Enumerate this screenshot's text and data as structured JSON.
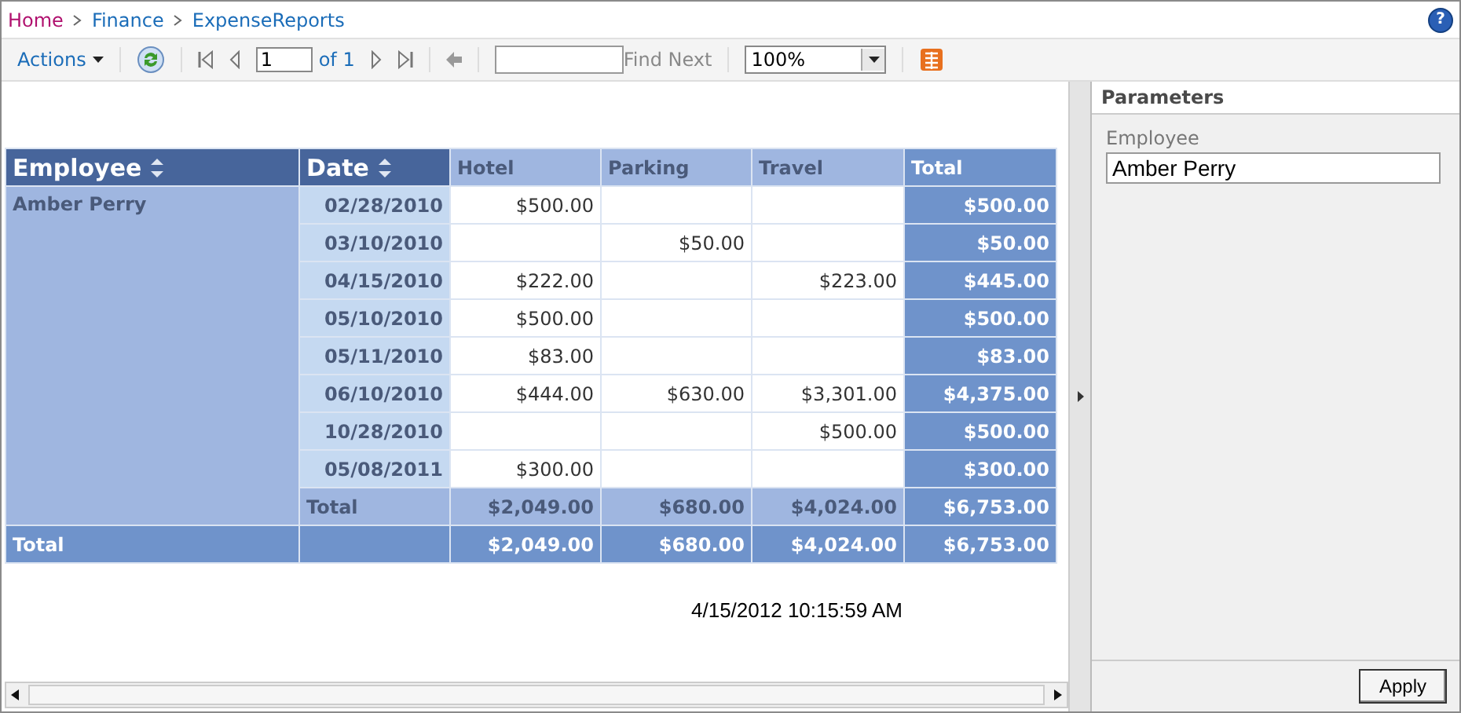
{
  "breadcrumb": [
    "Home",
    "Finance",
    "ExpenseReports"
  ],
  "help": "?",
  "toolbar": {
    "actions": "Actions",
    "page": "1",
    "page_of": "of 1",
    "find_label": "Find Next",
    "zoom": "100%"
  },
  "table": {
    "columns": [
      {
        "label": "Employee",
        "sortable": true
      },
      {
        "label": "Date",
        "sortable": true
      },
      {
        "label": "Hotel",
        "sortable": false
      },
      {
        "label": "Parking",
        "sortable": false
      },
      {
        "label": "Travel",
        "sortable": false
      },
      {
        "label": "Total",
        "sortable": false
      }
    ],
    "employee": "Amber Perry",
    "rows": [
      {
        "date": "02/28/2010",
        "hotel": "$500.00",
        "total": "$500.00"
      },
      {
        "date": "03/10/2010",
        "parking": "$50.00",
        "total": "$50.00"
      },
      {
        "date": "04/15/2010",
        "hotel": "$222.00",
        "travel": "$223.00",
        "total": "$445.00"
      },
      {
        "date": "05/10/2010",
        "hotel": "$500.00",
        "total": "$500.00"
      },
      {
        "date": "05/11/2010",
        "hotel": "$83.00",
        "total": "$83.00"
      },
      {
        "date": "06/10/2010",
        "hotel": "$444.00",
        "parking": "$630.00",
        "travel": "$3,301.00",
        "total": "$4,375.00"
      },
      {
        "date": "10/28/2010",
        "travel": "$500.00",
        "total": "$500.00"
      },
      {
        "date": "05/08/2011",
        "hotel": "$300.00",
        "total": "$300.00"
      }
    ],
    "subtotal": {
      "label": "Total",
      "hotel": "$2,049.00",
      "parking": "$680.00",
      "travel": "$4,024.00",
      "total": "$6,753.00"
    },
    "grand_total": {
      "label": "Total",
      "hotel": "$2,049.00",
      "parking": "$680.00",
      "travel": "$4,024.00",
      "total": "$6,753.00"
    }
  },
  "timestamp": "4/15/2012 10:15:59 AM",
  "parameters": {
    "title": "Parameters",
    "label": "Employee",
    "value": "Amber Perry",
    "button": "Apply"
  }
}
